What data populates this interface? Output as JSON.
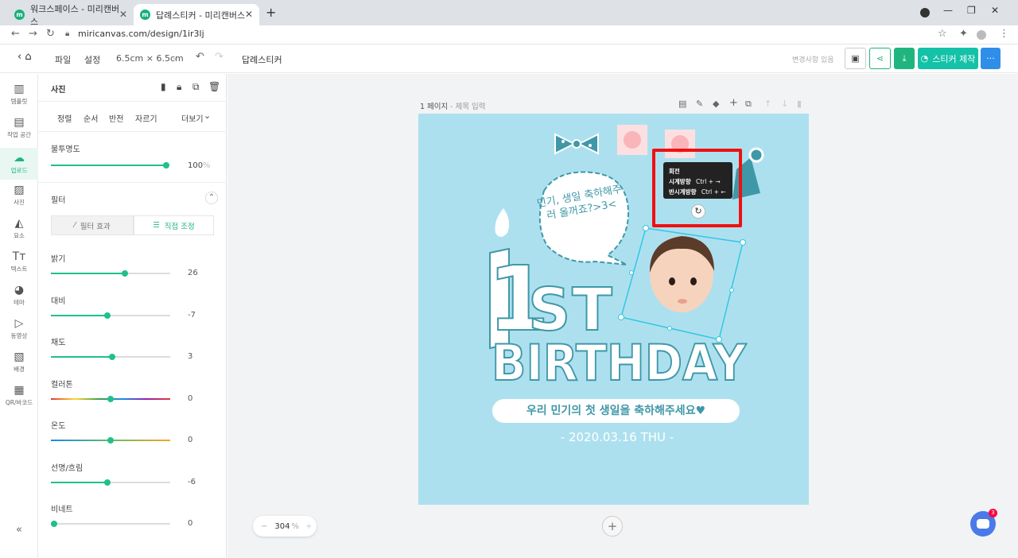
{
  "browser": {
    "tabs": [
      {
        "title": "워크스페이스 - 미리캔버스",
        "active": false
      },
      {
        "title": "답례스티커 - 미리캔버스",
        "active": true
      }
    ],
    "url": "miricanvas.com/design/1ir3lj"
  },
  "header": {
    "file": "파일",
    "settings": "설정",
    "size": "6.5cm × 6.5cm",
    "doc_title": "답례스티커",
    "save_status": "변경사항 있음",
    "make_button": "스티커 제작",
    "more": "···"
  },
  "rail": {
    "items": [
      {
        "label": "템플릿",
        "icon": "template-icon"
      },
      {
        "label": "작업 공간",
        "icon": "workspace-icon"
      },
      {
        "label": "업로드",
        "icon": "upload-icon",
        "active": true
      },
      {
        "label": "사진",
        "icon": "photo-icon"
      },
      {
        "label": "요소",
        "icon": "element-icon"
      },
      {
        "label": "텍스트",
        "icon": "text-icon"
      },
      {
        "label": "테마",
        "icon": "theme-icon"
      },
      {
        "label": "동영상",
        "icon": "video-icon"
      },
      {
        "label": "배경",
        "icon": "background-icon"
      },
      {
        "label": "QR/바코드",
        "icon": "qr-icon"
      }
    ],
    "collapse": "«"
  },
  "panel": {
    "title": "사진",
    "tabs": [
      "정렬",
      "순서",
      "반전",
      "자르기"
    ],
    "more": "더보기",
    "opacity_label": "불투명도",
    "opacity_value": "100",
    "opacity_unit": "%",
    "filter_label": "필터",
    "filter_effect": "필터 효과",
    "direct_adjust": "직접 조정",
    "adjustments": [
      {
        "label": "밝기",
        "value": "26",
        "pct": 0.62
      },
      {
        "label": "대비",
        "value": "-7",
        "pct": 0.47
      },
      {
        "label": "채도",
        "value": "3",
        "pct": 0.51
      },
      {
        "label": "컬러톤",
        "value": "0",
        "pct": 0.5
      },
      {
        "label": "온도",
        "value": "0",
        "pct": 0.5
      },
      {
        "label": "선명/흐림",
        "value": "-6",
        "pct": 0.47
      },
      {
        "label": "비네트",
        "value": "0",
        "pct": 0.0
      }
    ]
  },
  "workspace": {
    "page_label": "1 페이지",
    "page_title_placeholder": "- 제목 입력",
    "zoom": "304",
    "zoom_unit": "%",
    "chat_badge": "3"
  },
  "tooltip": {
    "title": "회전",
    "cw": "시계방향",
    "cw_key": "Ctrl + →",
    "ccw": "반시계방향",
    "ccw_key": "Ctrl + ←"
  },
  "artwork": {
    "speech": "민기, 생일 축하해주러 올꺼죠?>3<",
    "big1": "1",
    "st": "ST",
    "birthday": "BIRTHDAY",
    "message": "우리 민기의 첫 생일을 축하해주세요♥",
    "date": "- 2020.03.16 THU -"
  },
  "colors": {
    "accent": "#1fb57e",
    "accent2": "#13c2a7",
    "blue": "#2f8ee8",
    "art_bg": "#ade0ef",
    "teal": "#3f98a8"
  }
}
